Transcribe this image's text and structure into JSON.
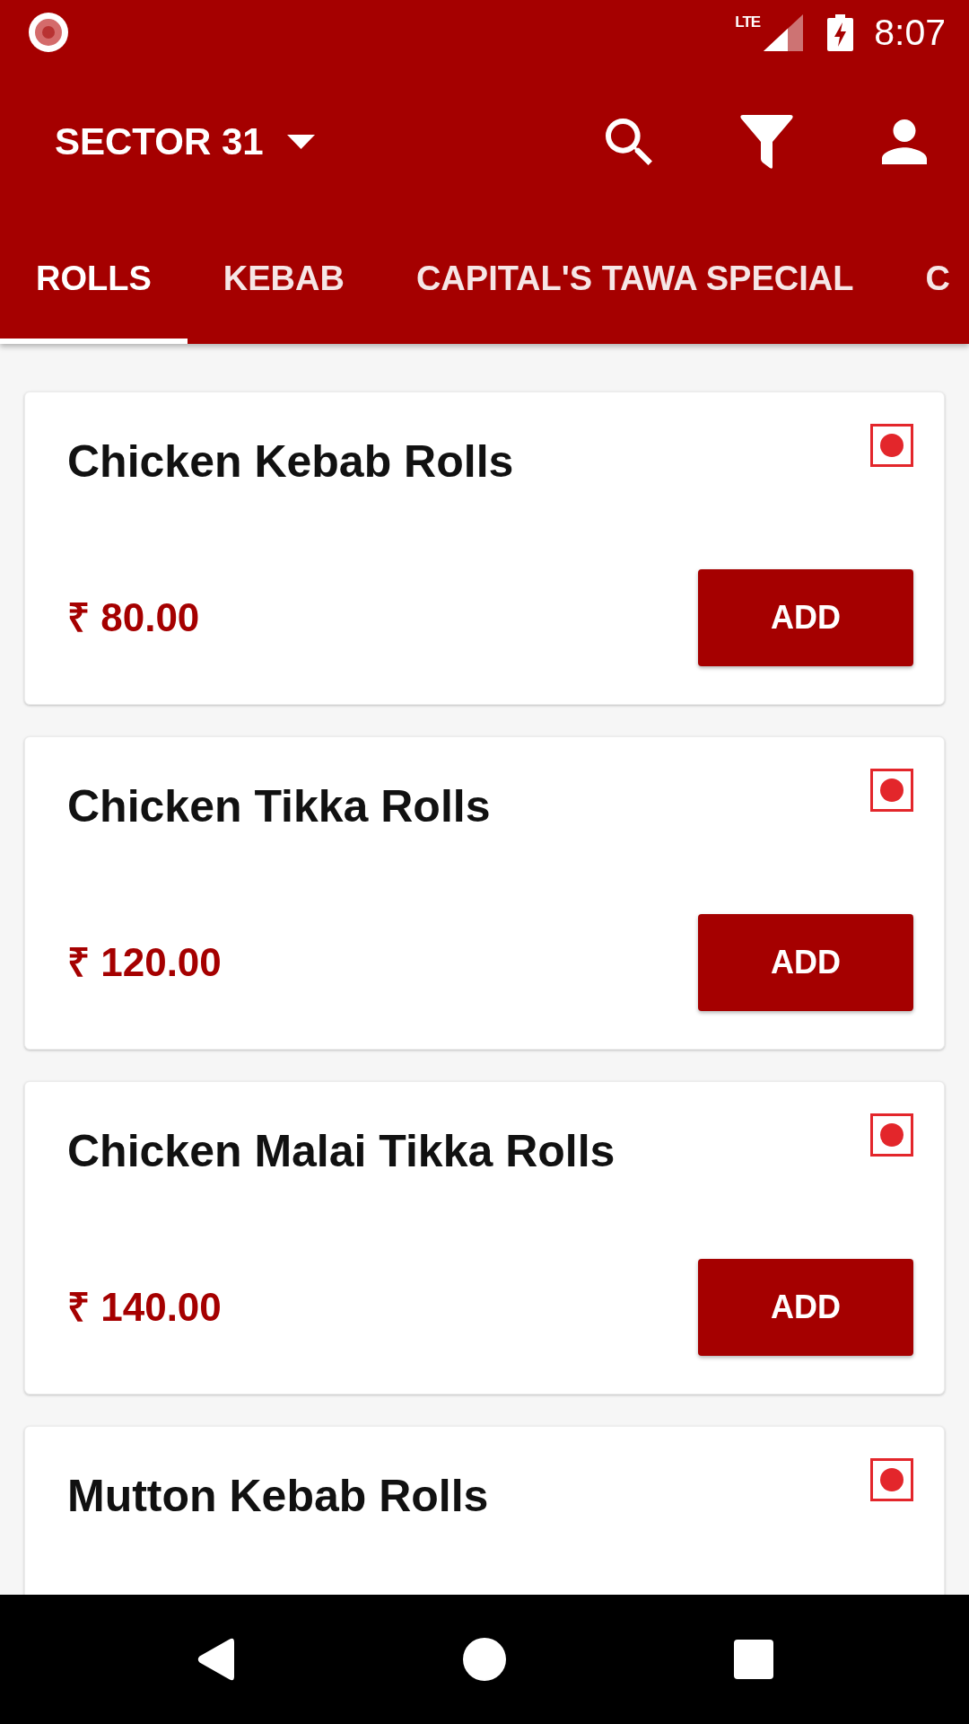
{
  "status_bar": {
    "network": "LTE",
    "time": "8:07"
  },
  "toolbar": {
    "location": "SECTOR 31"
  },
  "tabs": [
    {
      "label": "ROLLS",
      "selected": true
    },
    {
      "label": "KEBAB",
      "selected": false
    },
    {
      "label": "CAPITAL'S TAWA SPECIAL",
      "selected": false
    },
    {
      "label": "C",
      "selected": false
    }
  ],
  "items": [
    {
      "name": "Chicken Kebab Rolls",
      "price": "₹ 80.00",
      "button": "ADD"
    },
    {
      "name": "Chicken Tikka Rolls",
      "price": "₹ 120.00",
      "button": "ADD"
    },
    {
      "name": "Chicken Malai Tikka Rolls",
      "price": "₹ 140.00",
      "button": "ADD"
    },
    {
      "name": "Mutton Kebab Rolls"
    }
  ]
}
